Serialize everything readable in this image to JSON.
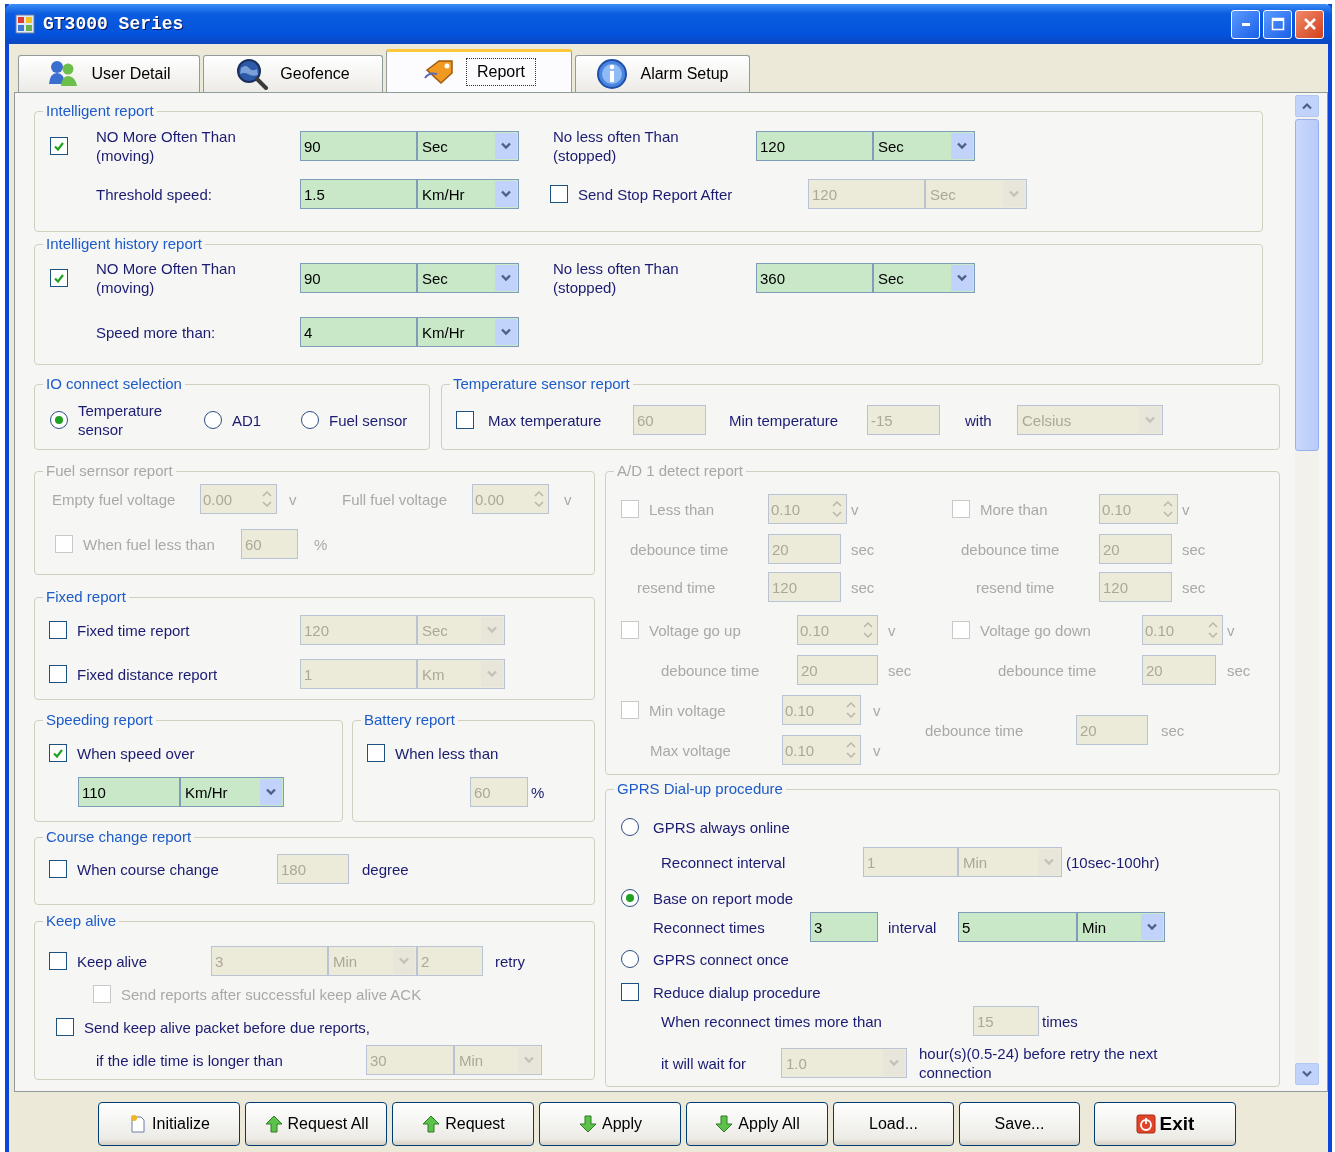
{
  "window": {
    "title": "GT3000 Series"
  },
  "tabs": [
    {
      "label": "User Detail",
      "selected": false
    },
    {
      "label": "Geofence",
      "selected": false
    },
    {
      "label": "Report",
      "selected": true
    },
    {
      "label": "Alarm Setup",
      "selected": false
    }
  ],
  "top_groups": [
    {
      "title": "Intelligent report",
      "disabled": false,
      "lines": [
        {
          "items": [
            {
              "kind": "check",
              "label": "NO More Often Than\n(moving)",
              "checked": true,
              "disabled": false
            },
            {
              "kind": "input",
              "value": "90",
              "disabled": false
            },
            {
              "kind": "combo",
              "value": "Sec",
              "disabled": false
            },
            {
              "kind": "text",
              "text": "No less often Than\n(stopped)",
              "disabled": false
            },
            {
              "kind": "input",
              "value": "120",
              "disabled": false
            },
            {
              "kind": "combo",
              "value": "Sec",
              "disabled": false
            }
          ]
        },
        {
          "items": [
            {
              "kind": "text",
              "text": "Threshold speed:",
              "disabled": false
            },
            {
              "kind": "input",
              "value": "1.5",
              "disabled": false
            },
            {
              "kind": "combo",
              "value": "Km/Hr",
              "disabled": false
            },
            {
              "kind": "check",
              "label": "Send Stop Report After",
              "checked": false,
              "disabled": false
            },
            {
              "kind": "input",
              "value": "120",
              "disabled": true
            },
            {
              "kind": "combo",
              "value": "Sec",
              "disabled": true
            }
          ]
        }
      ]
    },
    {
      "title": "Intelligent history report",
      "disabled": false,
      "lines": [
        {
          "items": [
            {
              "kind": "check",
              "label": "NO More Often Than\n(moving)",
              "checked": true,
              "disabled": false
            },
            {
              "kind": "input",
              "value": "90",
              "disabled": false
            },
            {
              "kind": "combo",
              "value": "Sec",
              "disabled": false
            },
            {
              "kind": "text",
              "text": "No less often Than\n(stopped)",
              "disabled": false
            },
            {
              "kind": "input",
              "value": "360",
              "disabled": false
            },
            {
              "kind": "combo",
              "value": "Sec",
              "disabled": false
            }
          ]
        },
        {
          "items": [
            {
              "kind": "text",
              "text": "Speed more than:",
              "disabled": false
            },
            {
              "kind": "input",
              "value": "4",
              "disabled": false
            },
            {
              "kind": "combo",
              "value": "Km/Hr",
              "disabled": false
            }
          ]
        }
      ]
    }
  ],
  "middle_groups": [
    {
      "title": "IO connect selection",
      "disabled": false,
      "lines": [
        {
          "items": [
            {
              "kind": "radio",
              "label": "Temperature\nsensor",
              "selected": true,
              "disabled": false
            },
            {
              "kind": "radio",
              "label": "AD1",
              "selected": false,
              "disabled": false
            },
            {
              "kind": "radio",
              "label": "Fuel sensor",
              "selected": false,
              "disabled": false
            }
          ]
        }
      ]
    },
    {
      "title": "Temperature sensor report",
      "disabled": false,
      "lines": [
        {
          "items": [
            {
              "kind": "check",
              "label": "Max temperature",
              "checked": false,
              "disabled": false
            },
            {
              "kind": "input",
              "value": "60",
              "disabled": true
            },
            {
              "kind": "text",
              "text": "Min temperature",
              "disabled": false
            },
            {
              "kind": "input",
              "value": "-15",
              "disabled": true
            },
            {
              "kind": "text",
              "text": "with",
              "disabled": false
            },
            {
              "kind": "combo",
              "value": "Celsius",
              "disabled": true
            }
          ]
        }
      ]
    }
  ],
  "left_column": [
    {
      "kind": "group",
      "title": "Fuel sernsor report",
      "disabled": true,
      "lines": [
        {
          "items": [
            {
              "kind": "text",
              "text": "Empty fuel voltage",
              "disabled": true
            },
            {
              "kind": "spin",
              "value": "0.00",
              "disabled": true
            },
            {
              "kind": "text",
              "text": "v",
              "disabled": true
            },
            {
              "kind": "text",
              "text": "Full fuel voltage",
              "disabled": true
            },
            {
              "kind": "spin",
              "value": "0.00",
              "disabled": true
            },
            {
              "kind": "text",
              "text": "v",
              "disabled": true
            }
          ]
        },
        {
          "items": [
            {
              "kind": "check",
              "label": "When fuel less than",
              "checked": false,
              "disabled": true
            },
            {
              "kind": "input",
              "value": "60",
              "disabled": true
            },
            {
              "kind": "text",
              "text": "%",
              "disabled": true
            }
          ]
        }
      ]
    },
    {
      "kind": "group",
      "title": "Fixed report",
      "disabled": false,
      "lines": [
        {
          "items": [
            {
              "kind": "check",
              "label": "Fixed time report",
              "checked": false,
              "disabled": false
            },
            {
              "kind": "input",
              "value": "120",
              "disabled": true
            },
            {
              "kind": "combo",
              "value": "Sec",
              "disabled": true
            }
          ]
        },
        {
          "items": [
            {
              "kind": "check",
              "label": "Fixed distance report",
              "checked": false,
              "disabled": false
            },
            {
              "kind": "input",
              "value": "1",
              "disabled": true
            },
            {
              "kind": "combo",
              "value": "Km",
              "disabled": true
            }
          ]
        }
      ]
    },
    {
      "kind": "pair",
      "groups": [
        {
          "title": "Speeding report",
          "disabled": false,
          "lines": [
            {
              "items": [
                {
                  "kind": "check",
                  "label": "When speed over",
                  "checked": true,
                  "disabled": false
                }
              ]
            },
            {
              "items": [
                {
                  "kind": "input",
                  "value": "110",
                  "disabled": false
                },
                {
                  "kind": "combo",
                  "value": "Km/Hr",
                  "disabled": false
                }
              ]
            }
          ]
        },
        {
          "title": "Battery report",
          "disabled": false,
          "lines": [
            {
              "items": [
                {
                  "kind": "check",
                  "label": "When less than",
                  "checked": false,
                  "disabled": false
                }
              ]
            },
            {
              "items": [
                {
                  "kind": "input",
                  "value": "60",
                  "disabled": true
                },
                {
                  "kind": "text",
                  "text": "%",
                  "disabled": false
                }
              ]
            }
          ]
        }
      ]
    },
    {
      "kind": "group",
      "title": "Course change report",
      "disabled": false,
      "lines": [
        {
          "items": [
            {
              "kind": "check",
              "label": "When course change",
              "checked": false,
              "disabled": false
            },
            {
              "kind": "input",
              "value": "180",
              "disabled": true
            },
            {
              "kind": "text",
              "text": "degree",
              "disabled": false
            }
          ]
        }
      ]
    },
    {
      "kind": "group",
      "title": "Keep alive",
      "disabled": false,
      "lines": [
        {
          "items": [
            {
              "kind": "check",
              "label": "Keep alive",
              "checked": false,
              "disabled": false
            },
            {
              "kind": "input",
              "value": "3",
              "disabled": true
            },
            {
              "kind": "combo",
              "value": "Min",
              "disabled": true
            },
            {
              "kind": "input",
              "value": "2",
              "disabled": true
            },
            {
              "kind": "text",
              "text": "retry",
              "disabled": false
            }
          ]
        },
        {
          "items": [
            {
              "kind": "check",
              "label": "Send reports after successful keep alive ACK",
              "checked": false,
              "disabled": true
            }
          ]
        },
        {
          "items": [
            {
              "kind": "check",
              "label": "Send keep alive packet before due reports,",
              "checked": false,
              "disabled": false
            }
          ]
        },
        {
          "items": [
            {
              "kind": "text",
              "text": "if the idle time is longer than",
              "disabled": false
            },
            {
              "kind": "input",
              "value": "30",
              "disabled": true
            },
            {
              "kind": "combo",
              "value": "Min",
              "disabled": true
            }
          ]
        }
      ]
    }
  ],
  "right_column": [
    {
      "title": "A/D 1 detect report",
      "disabled": true,
      "lines": [
        {
          "items": [
            {
              "kind": "check",
              "label": "Less than",
              "checked": false,
              "disabled": true
            },
            {
              "kind": "spin",
              "value": "0.10",
              "disabled": true
            },
            {
              "kind": "text",
              "text": "v",
              "disabled": true
            },
            {
              "kind": "check",
              "label": "More than",
              "checked": false,
              "disabled": true
            },
            {
              "kind": "spin",
              "value": "0.10",
              "disabled": true
            },
            {
              "kind": "text",
              "text": "v",
              "disabled": true
            }
          ]
        },
        {
          "items": [
            {
              "kind": "text",
              "text": "debounce time",
              "disabled": true
            },
            {
              "kind": "input",
              "value": "20",
              "disabled": true
            },
            {
              "kind": "text",
              "text": "sec",
              "disabled": true
            },
            {
              "kind": "text",
              "text": "debounce time",
              "disabled": true
            },
            {
              "kind": "input",
              "value": "20",
              "disabled": true
            },
            {
              "kind": "text",
              "text": "sec",
              "disabled": true
            }
          ]
        },
        {
          "items": [
            {
              "kind": "text",
              "text": "resend time",
              "disabled": true
            },
            {
              "kind": "input",
              "value": "120",
              "disabled": true
            },
            {
              "kind": "text",
              "text": "sec",
              "disabled": true
            },
            {
              "kind": "text",
              "text": "resend time",
              "disabled": true
            },
            {
              "kind": "input",
              "value": "120",
              "disabled": true
            },
            {
              "kind": "text",
              "text": "sec",
              "disabled": true
            }
          ]
        },
        {
          "items": [
            {
              "kind": "check",
              "label": "Voltage go up",
              "checked": false,
              "disabled": true
            },
            {
              "kind": "spin",
              "value": "0.10",
              "disabled": true
            },
            {
              "kind": "text",
              "text": "v",
              "disabled": true
            },
            {
              "kind": "check",
              "label": "Voltage go down",
              "checked": false,
              "disabled": true
            },
            {
              "kind": "spin",
              "value": "0.10",
              "disabled": true
            },
            {
              "kind": "text",
              "text": "v",
              "disabled": true
            }
          ]
        },
        {
          "items": [
            {
              "kind": "text",
              "text": "debounce time",
              "disabled": true
            },
            {
              "kind": "input",
              "value": "20",
              "disabled": true
            },
            {
              "kind": "text",
              "text": "sec",
              "disabled": true
            },
            {
              "kind": "text",
              "text": "debounce time",
              "disabled": true
            },
            {
              "kind": "input",
              "value": "20",
              "disabled": true
            },
            {
              "kind": "text",
              "text": "sec",
              "disabled": true
            }
          ]
        },
        {
          "items": [
            {
              "kind": "check",
              "label": "Min voltage",
              "checked": false,
              "disabled": true
            },
            {
              "kind": "spin",
              "value": "0.10",
              "disabled": true
            },
            {
              "kind": "text",
              "text": "v",
              "disabled": true
            },
            {
              "kind": "text",
              "text": "debounce time",
              "disabled": true
            },
            {
              "kind": "input",
              "value": "20",
              "disabled": true
            },
            {
              "kind": "text",
              "text": "sec",
              "disabled": true
            }
          ]
        },
        {
          "items": [
            {
              "kind": "text",
              "text": "Max voltage",
              "disabled": true
            },
            {
              "kind": "spin",
              "value": "0.10",
              "disabled": true
            },
            {
              "kind": "text",
              "text": "v",
              "disabled": true
            }
          ]
        }
      ]
    },
    {
      "title": "GPRS Dial-up procedure",
      "disabled": false,
      "lines": [
        {
          "items": [
            {
              "kind": "radio",
              "label": "GPRS always online",
              "selected": false,
              "disabled": false
            }
          ]
        },
        {
          "items": [
            {
              "kind": "text",
              "text": "Reconnect interval",
              "disabled": false
            },
            {
              "kind": "input",
              "value": "1",
              "disabled": true
            },
            {
              "kind": "combo",
              "value": "Min",
              "disabled": true
            },
            {
              "kind": "text",
              "text": "(10sec-100hr)",
              "disabled": false
            }
          ]
        },
        {
          "items": [
            {
              "kind": "radio",
              "label": "Base on report mode",
              "selected": true,
              "disabled": false
            }
          ]
        },
        {
          "items": [
            {
              "kind": "text",
              "text": "Reconnect times",
              "disabled": false
            },
            {
              "kind": "input",
              "value": "3",
              "disabled": false
            },
            {
              "kind": "text",
              "text": "interval",
              "disabled": false
            },
            {
              "kind": "input",
              "value": "5",
              "disabled": false
            },
            {
              "kind": "combo",
              "value": "Min",
              "disabled": false
            }
          ]
        },
        {
          "items": [
            {
              "kind": "radio",
              "label": "GPRS connect once",
              "selected": false,
              "disabled": false
            }
          ]
        },
        {
          "items": [
            {
              "kind": "check",
              "label": "Reduce dialup procedure",
              "checked": false,
              "disabled": false
            }
          ]
        },
        {
          "items": [
            {
              "kind": "text",
              "text": "When reconnect times more than",
              "disabled": false
            },
            {
              "kind": "input",
              "value": "15",
              "disabled": true
            },
            {
              "kind": "text",
              "text": "times",
              "disabled": false
            }
          ]
        },
        {
          "items": [
            {
              "kind": "text",
              "text": "it will wait for",
              "disabled": false
            },
            {
              "kind": "combo",
              "value": "1.0",
              "disabled": true
            },
            {
              "kind": "text",
              "text": "hour(s)(0.5-24) before retry the next connection",
              "disabled": false
            }
          ]
        }
      ]
    }
  ],
  "buttons": [
    {
      "label": "Initialize"
    },
    {
      "label": "Request All"
    },
    {
      "label": "Request"
    },
    {
      "label": "Apply"
    },
    {
      "label": "Apply All"
    },
    {
      "label": "Load..."
    },
    {
      "label": "Save..."
    },
    {
      "label": "Exit"
    }
  ]
}
